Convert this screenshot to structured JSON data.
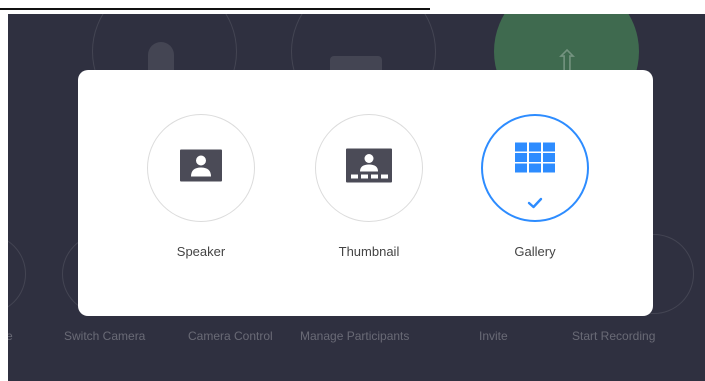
{
  "background_controls": {
    "bottom_labels": [
      "e",
      "Switch Camera",
      "Camera Control",
      "Manage Participants",
      "Invite",
      "Start Recording"
    ]
  },
  "view_picker": {
    "options": [
      {
        "label": "Speaker",
        "icon": "speaker-view-icon",
        "selected": false
      },
      {
        "label": "Thumbnail",
        "icon": "thumbnail-view-icon",
        "selected": false
      },
      {
        "label": "Gallery",
        "icon": "gallery-view-icon",
        "selected": true
      }
    ]
  },
  "colors": {
    "accent": "#2d8cff",
    "icon_gray": "#4b4b57",
    "backdrop": "#2f3040",
    "ring_gray": "#dcdcdc"
  }
}
